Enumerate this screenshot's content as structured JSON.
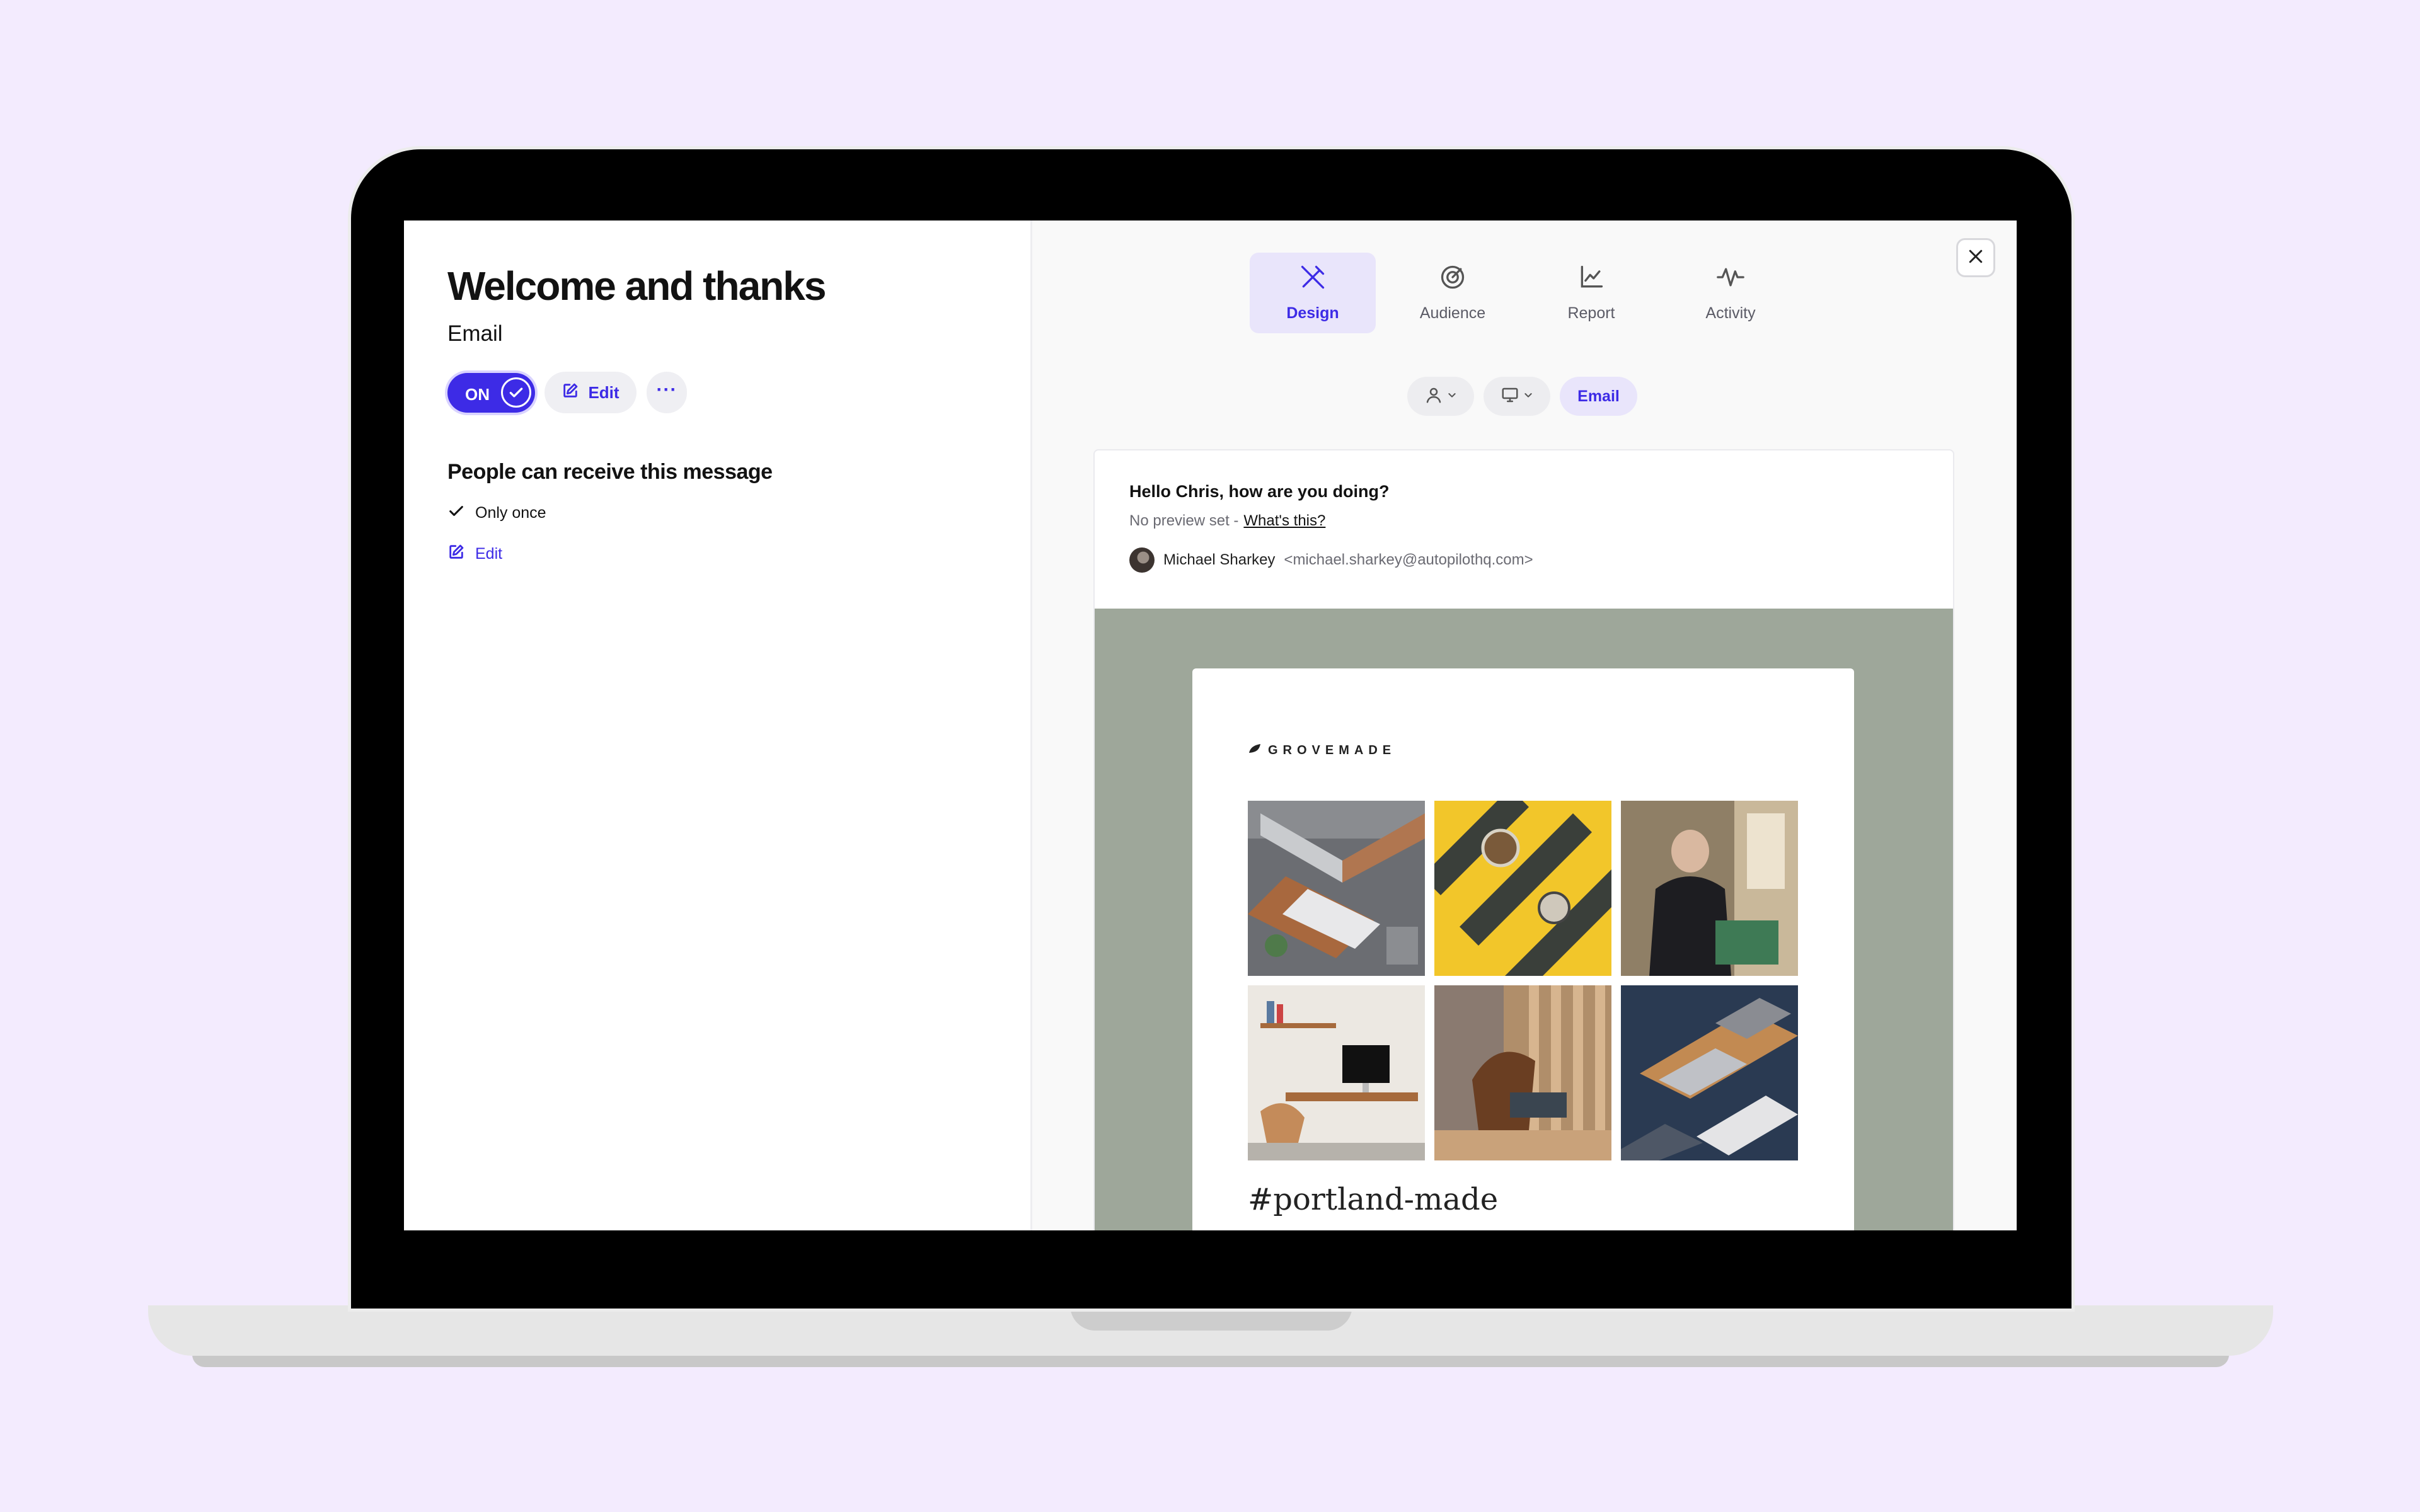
{
  "app": {
    "message_title": "Welcome and thanks",
    "message_type": "Email",
    "toggle_label": "ON",
    "edit_label": "Edit",
    "more_label": "···"
  },
  "rules": {
    "title": "People can receive this message",
    "frequency": "Only once",
    "edit_label": "Edit"
  },
  "tabs": [
    {
      "label": "Design",
      "icon": "pencil-ruler-icon",
      "active": true
    },
    {
      "label": "Audience",
      "icon": "target-icon",
      "active": false
    },
    {
      "label": "Report",
      "icon": "line-chart-icon",
      "active": false
    },
    {
      "label": "Activity",
      "icon": "pulse-icon",
      "active": false
    }
  ],
  "preview_controls": {
    "contact_selector": "person-icon",
    "device_selector": "desktop-icon",
    "format_label": "Email"
  },
  "email_preview": {
    "subject": "Hello Chris, how are you doing?",
    "preview_text": "No preview set -",
    "preview_help_link": "What's this?",
    "sender_name": "Michael Sharkey",
    "sender_email": "<michael.sharkey@autopilothq.com>",
    "brand": "GROVEMADE",
    "hashtag": "#portland-made"
  },
  "colors": {
    "accent": "#3D2BE6",
    "accent_soft": "#E9E5FB",
    "page_background": "#F3EBFE",
    "email_background": "#9EA79A"
  }
}
